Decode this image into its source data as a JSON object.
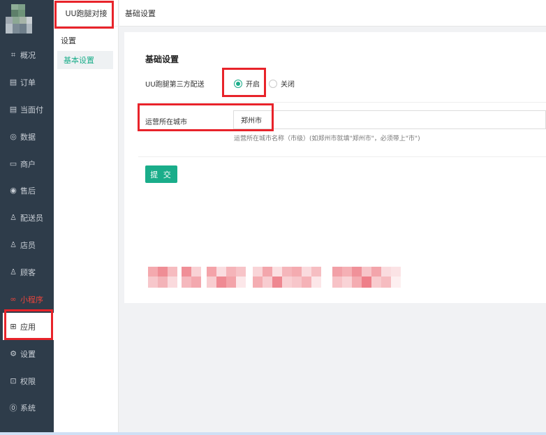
{
  "sidebar": {
    "items": [
      {
        "label": "概况",
        "icon": "overview-icon",
        "glyph": "⌗"
      },
      {
        "label": "订单",
        "icon": "order-icon",
        "glyph": "▤"
      },
      {
        "label": "当面付",
        "icon": "face-pay-icon",
        "glyph": "▤"
      },
      {
        "label": "数据",
        "icon": "chart-icon",
        "glyph": "◎"
      },
      {
        "label": "商户",
        "icon": "shop-icon",
        "glyph": "▭"
      },
      {
        "label": "售后",
        "icon": "after-sale-icon",
        "glyph": "◉"
      },
      {
        "label": "配送员",
        "icon": "courier-icon",
        "glyph": "♙"
      },
      {
        "label": "店员",
        "icon": "clerk-icon",
        "glyph": "♙"
      },
      {
        "label": "顾客",
        "icon": "customer-icon",
        "glyph": "♙"
      },
      {
        "label": "小程序",
        "icon": "miniprogram-icon",
        "glyph": "∞"
      },
      {
        "label": "应用",
        "icon": "apps-icon",
        "glyph": "⊞"
      },
      {
        "label": "设置",
        "icon": "settings-icon",
        "glyph": "⚙"
      },
      {
        "label": "权限",
        "icon": "lock-icon",
        "glyph": "⊡"
      },
      {
        "label": "系统",
        "icon": "system-icon",
        "glyph": "⓪"
      }
    ]
  },
  "subbar": {
    "title": "UU跑腿对接",
    "group": "设置",
    "active_item": "基本设置"
  },
  "topbar": {
    "title": "基础设置"
  },
  "form": {
    "title": "基础设置",
    "delivery_label": "UU跑腿第三方配送",
    "option_on": "开启",
    "option_off": "关闭",
    "city_label": "运营所在城市",
    "city_value": "郑州市",
    "city_hint": "运营所在城市名称（市级）(如郑州市就填\"郑州市\"，必须带上\"市\")",
    "submit_label": "提 交"
  },
  "colors": {
    "sidebar_bg": "#2e3c4a",
    "accent": "#1aad8a",
    "highlight": "#e8232a",
    "miniprogram": "#e8453c"
  }
}
